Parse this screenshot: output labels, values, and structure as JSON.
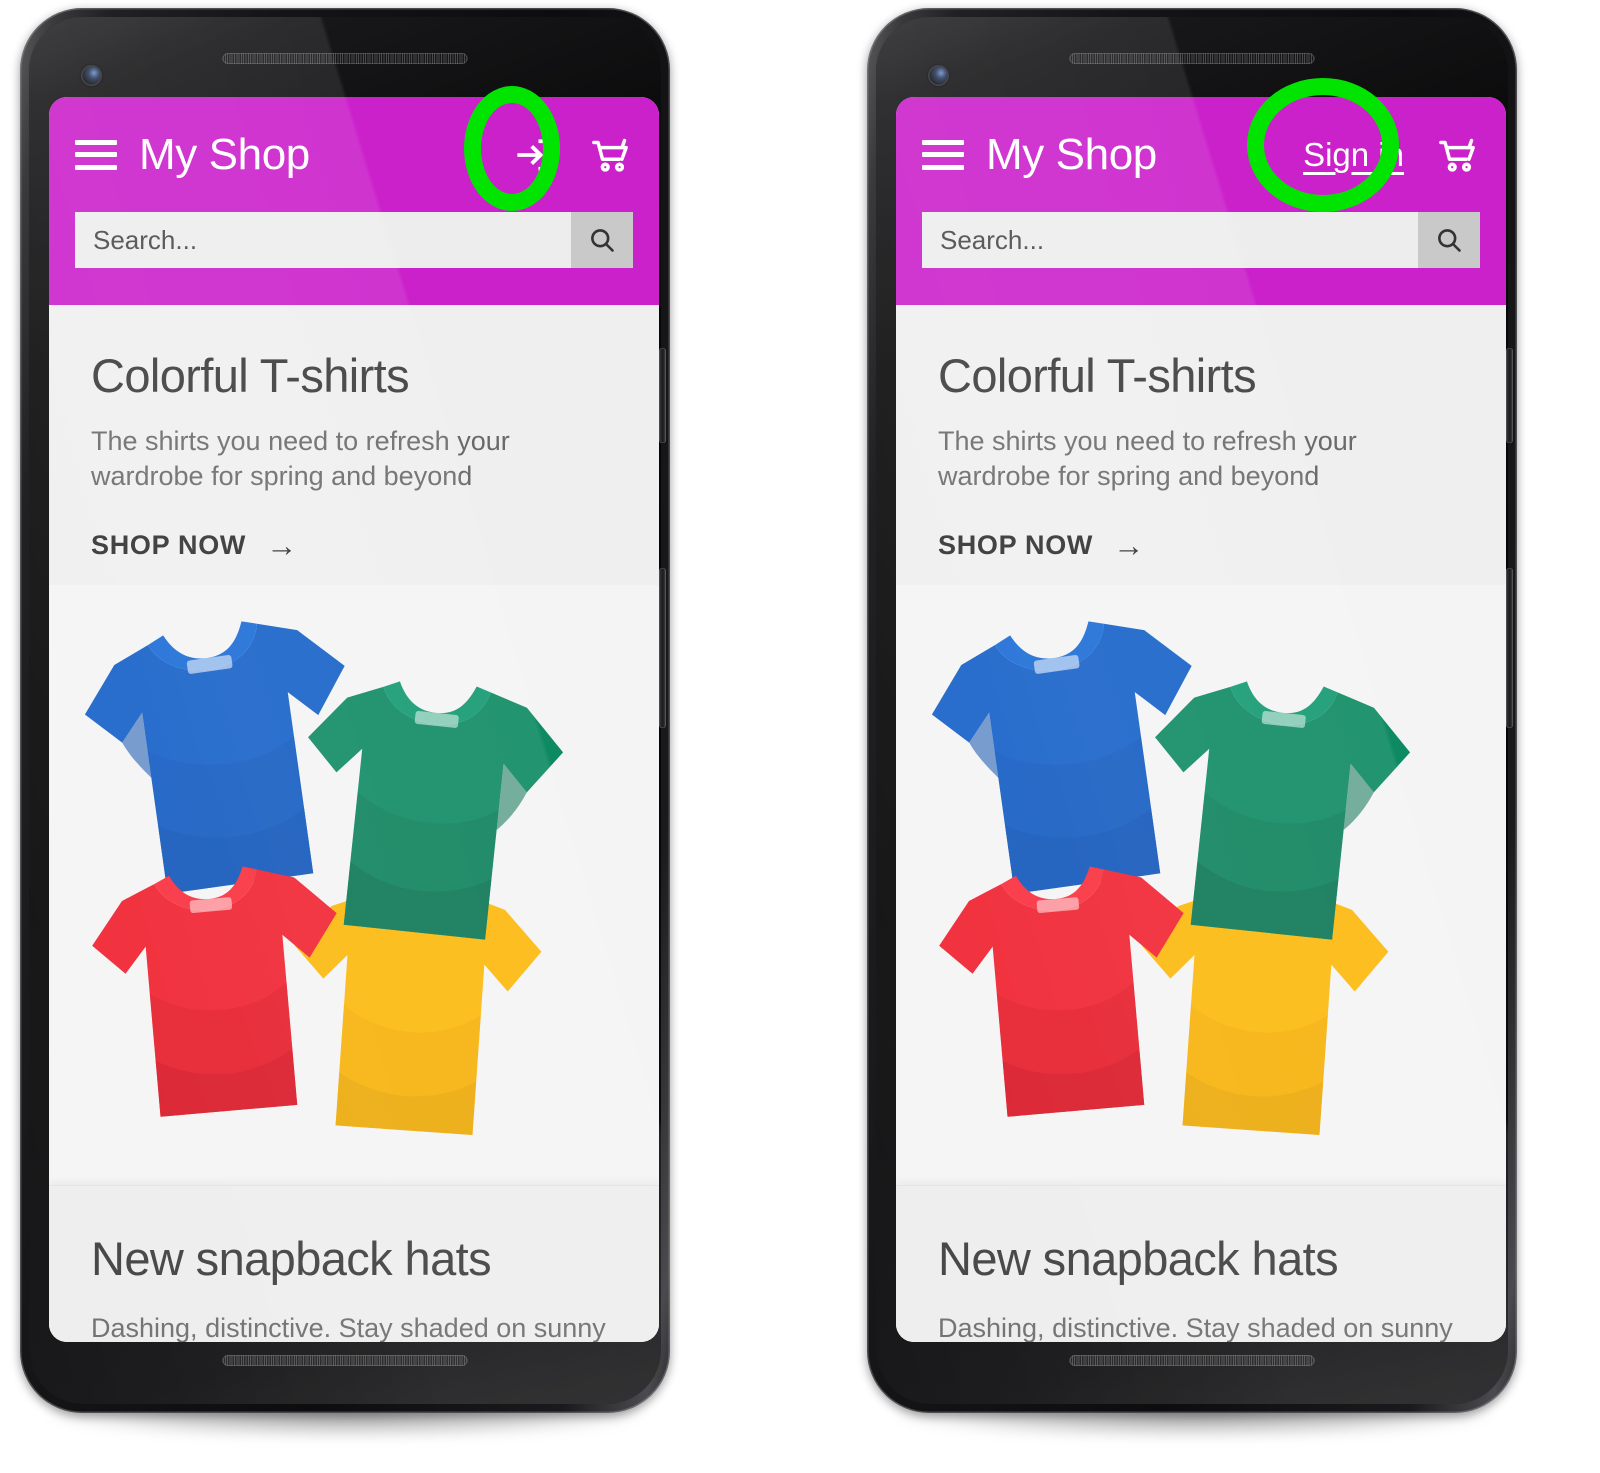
{
  "app": {
    "brand": "My Shop",
    "accent_magenta": "#CB21CB",
    "highlight_green": "#00E400",
    "screen_bg": "#EFEFEF"
  },
  "appbar": {
    "menu_icon": "hamburger-menu-icon",
    "cart_icon": "shopping-cart-icon",
    "login_icon": "login-arrow-into-bracket-icon",
    "signin_label": "Sign in"
  },
  "search": {
    "placeholder": "Search...",
    "value": "",
    "submit_icon": "magnifier-search-icon"
  },
  "cards": [
    {
      "title": "Colorful T-shirts",
      "subtitle": "The shirts you need to refresh your wardrobe for spring and beyond",
      "cta_label": "SHOP NOW",
      "cta_icon": "arrow-right-icon"
    },
    {
      "title": "New snapback hats",
      "subtitle": "Dashing, distinctive. Stay shaded on sunny"
    }
  ],
  "hero": {
    "alt": "four folded t-shirts",
    "shirts": [
      {
        "name": "blue-tshirt",
        "color": "#1560C8",
        "shade": "#1050AE"
      },
      {
        "name": "green-tshirt",
        "color": "#0E8A62",
        "shade": "#0A7252"
      },
      {
        "name": "red-tshirt",
        "color": "#F0212F",
        "shade": "#D01224"
      },
      {
        "name": "yellow-tshirt",
        "color": "#FCB80A",
        "shade": "#E8A206"
      }
    ]
  },
  "phones": [
    {
      "id": "phone-before",
      "highlight_target": "login-icon-button",
      "highlight_shape": "oval"
    },
    {
      "id": "phone-after",
      "highlight_target": "sign-in-text-link",
      "highlight_shape": "round"
    }
  ]
}
